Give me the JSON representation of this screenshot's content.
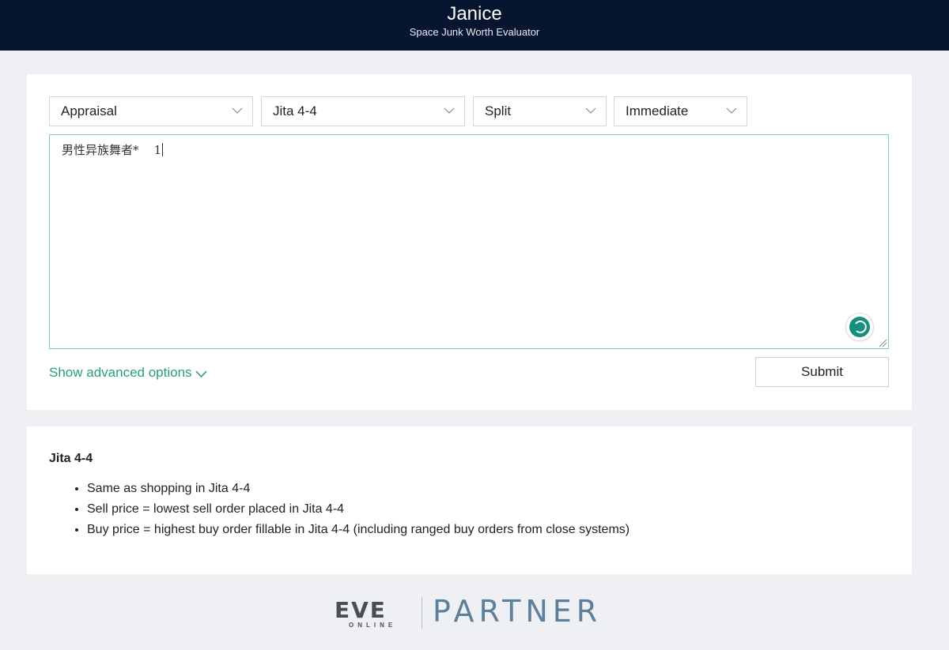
{
  "header": {
    "title": "Janice",
    "subtitle": "Space Junk Worth Evaluator"
  },
  "form": {
    "selects": [
      {
        "value": "Appraisal"
      },
      {
        "value": "Jita 4-4"
      },
      {
        "value": "Split"
      },
      {
        "value": "Immediate"
      }
    ],
    "textarea_value": "男性异族舞者*    1",
    "advanced_link": "Show advanced options",
    "submit_label": "Submit"
  },
  "info": {
    "title": "Jita 4-4",
    "items": [
      "Same as shopping in Jita 4-4",
      "Sell price = lowest sell order placed in Jita 4-4",
      "Buy price = highest buy order fillable in Jita 4-4 (including ranged buy orders from close systems)"
    ]
  },
  "footer": {
    "logo_word": "EVE",
    "logo_sub": "ONLINE",
    "partner": "PARTNER"
  },
  "colors": {
    "header_bg": "#061530",
    "accent": "#26a07c",
    "focus_border": "#7fd0b2",
    "partner": "#5c7f9c"
  }
}
